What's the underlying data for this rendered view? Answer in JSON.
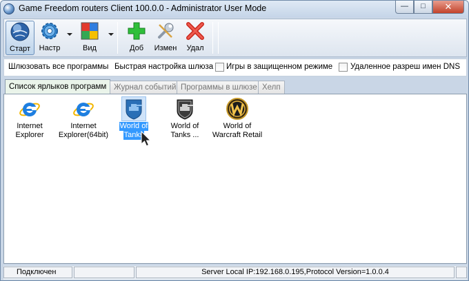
{
  "window": {
    "title": "Game Freedom routers Client 100.0.0 - Administrator User Mode",
    "app_icon": "globe-icon"
  },
  "toolbar": {
    "start_label": "Старт",
    "settings_label": "Настр",
    "view_label": "Вид",
    "add_label": "Доб",
    "edit_label": "Измен",
    "delete_label": "Удал"
  },
  "options": {
    "gateway_all": "Шлюзовать все программы",
    "quick_setup": "Быстрая настройка шлюза",
    "protected_mode": "Игры в защищенном режиме",
    "remote_dns": "Удаленное разреш имен DNS",
    "protected_mode_checked": false,
    "remote_dns_checked": false
  },
  "tabs": [
    {
      "label": "Список ярлыков программ",
      "active": true
    },
    {
      "label": "Журнал событий",
      "active": false
    },
    {
      "label": "Программы в шлюзе",
      "active": false
    },
    {
      "label": "Хелп",
      "active": false
    }
  ],
  "shortcuts": [
    {
      "line1": "Internet",
      "line2": "Explorer",
      "icon": "internet-explorer-icon"
    },
    {
      "line1": "Internet",
      "line2": "Explorer(64bit)",
      "icon": "internet-explorer-icon"
    },
    {
      "line1": "World of",
      "line2": "Tanks",
      "icon": "world-of-tanks-blue-icon",
      "selected": true
    },
    {
      "line1": "World of",
      "line2": "Tanks ...",
      "icon": "world-of-tanks-icon"
    },
    {
      "line1": "World of",
      "line2": "Warcraft Retail",
      "icon": "world-of-warcraft-icon"
    }
  ],
  "status": {
    "connection": "Подключен",
    "server_info": "Server Local IP:192.168.0.195,Protocol Version=1.0.0.4"
  }
}
